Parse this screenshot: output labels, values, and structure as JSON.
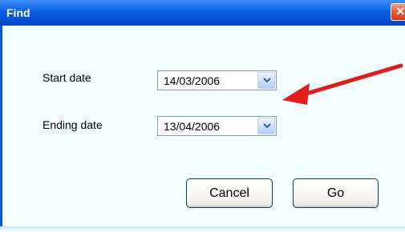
{
  "window": {
    "title": "Find"
  },
  "form": {
    "start_label": "Start date",
    "start_value": "14/03/2006",
    "end_label": "Ending date",
    "end_value": "13/04/2006"
  },
  "buttons": {
    "cancel": "Cancel",
    "go": "Go"
  },
  "icons": {
    "close": "close-icon",
    "dropdown": "chevron-down-icon",
    "annotation": "arrow-icon"
  },
  "colors": {
    "title_bar": "#0a5fe0",
    "close_button": "#e65c35",
    "background": "#f3ffff",
    "annotation_arrow": "#e51b1b"
  }
}
